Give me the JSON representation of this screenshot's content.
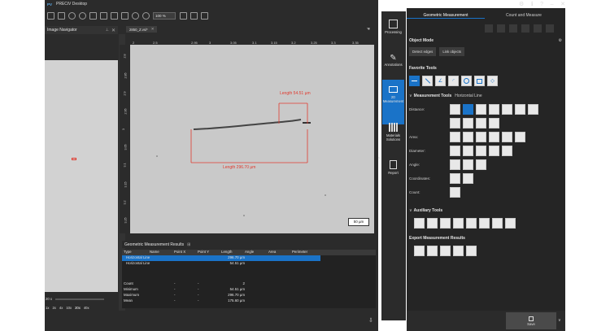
{
  "app": {
    "logo": "PV",
    "title": "PRECiV Desktop"
  },
  "toolbar": {
    "zoom_value": "100 %"
  },
  "image_navigator": {
    "title": "Image Navigator"
  },
  "image_tab": {
    "label": "2850_Z.vsi*"
  },
  "ruler_ticks": [
    "2",
    "2.5",
    "2.95",
    "3",
    "3.05",
    "3.1",
    "3.15",
    "3.2",
    "3.25",
    "3.3",
    "3.35"
  ],
  "left_ruler_ticks": [
    "2.8",
    "2.85",
    "2.9",
    "2.95",
    "3",
    "3.05",
    "3.1",
    "3.15",
    "3.2",
    "3.25"
  ],
  "annotations": {
    "length_small": "Length 54.51 µm",
    "length_large": "Length 296.70 µm",
    "scalebar": "50 µm"
  },
  "zoom_levels": {
    "value": "20 x",
    "levels": [
      "1x",
      "2x",
      "4x",
      "10x",
      "20x",
      "40x"
    ]
  },
  "results": {
    "title": "Geometric Measurement Results",
    "columns": [
      "Type",
      "Name",
      "Point X",
      "Point Y",
      "Length",
      "Angle",
      "Area",
      "Perimeter"
    ],
    "rows": [
      [
        "Horizontal Line",
        "",
        "",
        "",
        "296.70 µm",
        "",
        "",
        ""
      ],
      [
        "Horizontal Line",
        "",
        "",
        "",
        "54.51 µm",
        "",
        "",
        ""
      ]
    ],
    "stats": [
      [
        "Count",
        "-",
        "-",
        "0",
        "0",
        "2",
        "0",
        "0"
      ],
      [
        "Minimum",
        "-",
        "-",
        "-",
        "-",
        "54.51 µm",
        "-",
        "-"
      ],
      [
        "Maximum",
        "-",
        "-",
        "-",
        "-",
        "296.70 µm",
        "-",
        "-"
      ],
      [
        "Mean",
        "-",
        "-",
        "-",
        "-",
        "175.60 µm",
        "-",
        "-"
      ]
    ]
  },
  "sidebar": {
    "items": [
      {
        "label": "Processing"
      },
      {
        "label": "Annotations"
      },
      {
        "label": "2D Measurement"
      },
      {
        "label": "Materials Solutions"
      },
      {
        "label": "Report"
      }
    ]
  },
  "panel": {
    "tabs": [
      "Geometric Measurement",
      "Count and Measure"
    ],
    "object_mode": {
      "title": "Object Mode",
      "buttons": [
        "Detect edges",
        "Link objects"
      ]
    },
    "favorite_tools": {
      "title": "Favorite Tools"
    },
    "measurement_tools": {
      "title": "Measurement Tools",
      "current": "Horizontal Line"
    },
    "rows": {
      "distance": "Distance:",
      "area": "Area:",
      "diameter": "Diameter:",
      "angle": "Angle:",
      "coordinates": "Coordinates:",
      "count": "Count:"
    },
    "auxiliary_tools": {
      "title": "Auxiliary Tools"
    },
    "export": {
      "title": "Export Measurement Results"
    },
    "save": {
      "label": "Save"
    }
  },
  "colors": {
    "accent": "#1a73c8",
    "annotation": "#e03a2f",
    "dark_bg": "#2b2b2b",
    "panel_bg": "#252525"
  }
}
